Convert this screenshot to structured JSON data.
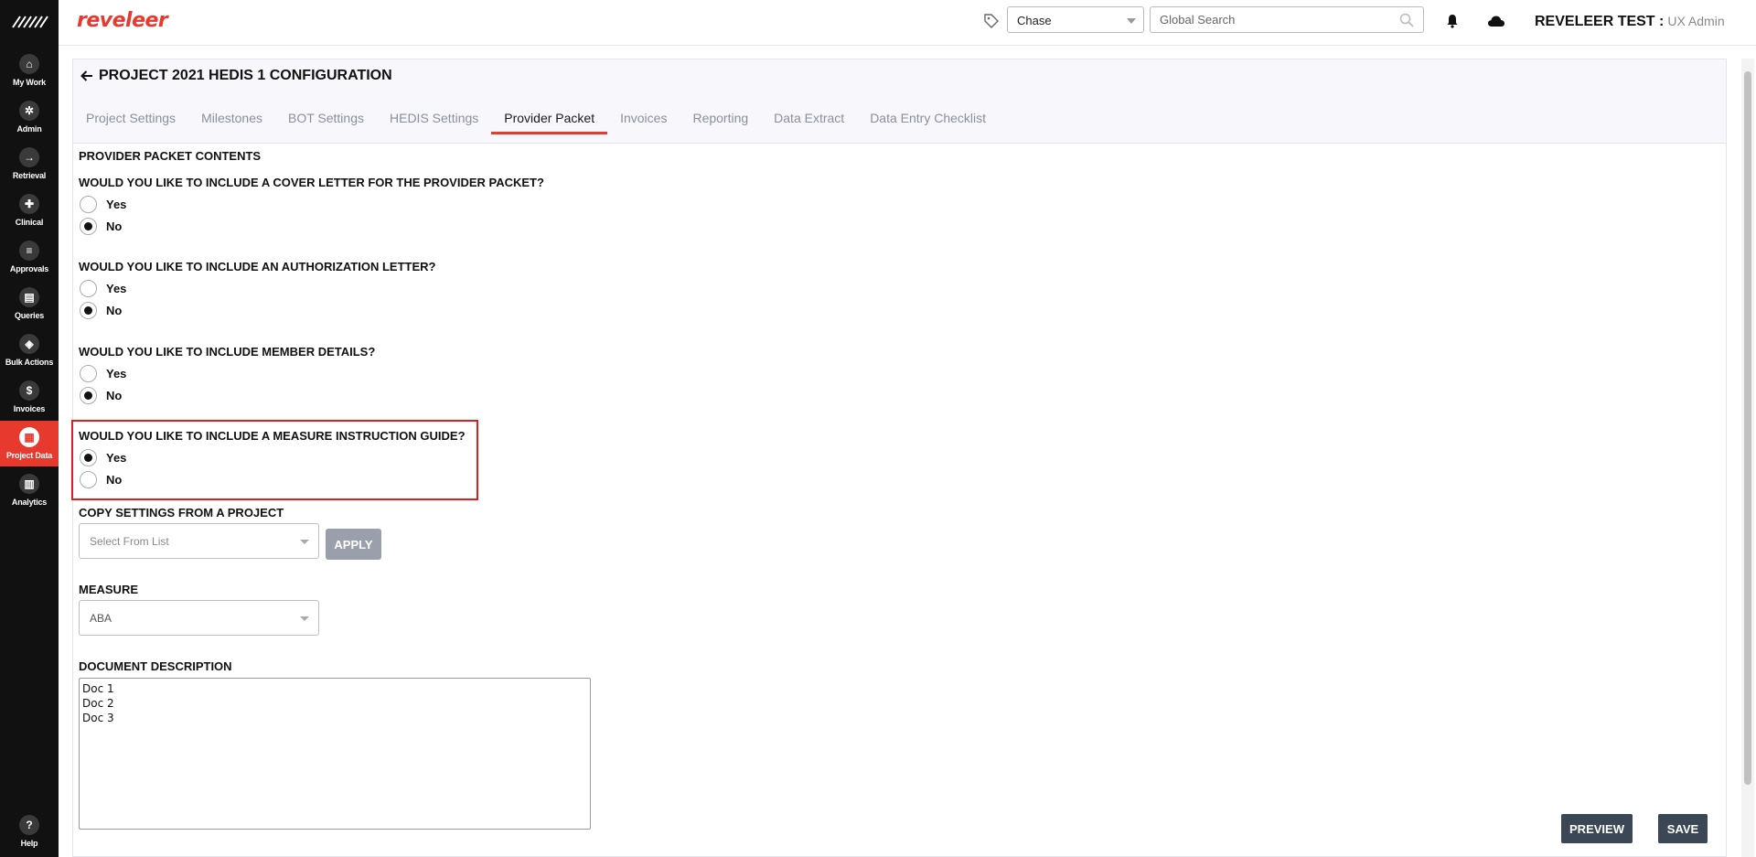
{
  "sidebar": {
    "items": [
      {
        "label": "My Work",
        "icon": "home-icon",
        "glyph": "⌂"
      },
      {
        "label": "Admin",
        "icon": "admin-icon",
        "glyph": "✲"
      },
      {
        "label": "Retrieval",
        "icon": "retrieval-icon",
        "glyph": "→"
      },
      {
        "label": "Clinical",
        "icon": "clinical-icon",
        "glyph": "✚"
      },
      {
        "label": "Approvals",
        "icon": "approvals-icon",
        "glyph": "≡"
      },
      {
        "label": "Queries",
        "icon": "queries-icon",
        "glyph": "▤"
      },
      {
        "label": "Bulk Actions",
        "icon": "layers-icon",
        "glyph": "◈"
      },
      {
        "label": "Invoices",
        "icon": "dollar-icon",
        "glyph": "$"
      },
      {
        "label": "Project Data",
        "icon": "project-data-icon",
        "glyph": "▦"
      },
      {
        "label": "Analytics",
        "icon": "analytics-icon",
        "glyph": "▥"
      }
    ],
    "help": {
      "label": "Help",
      "glyph": "?"
    }
  },
  "header": {
    "brand": "reveleer",
    "org_select": "Chase",
    "search_placeholder": "Global Search",
    "user_name": "REVELEER TEST :",
    "user_role": "UX Admin"
  },
  "page": {
    "title": "PROJECT 2021 HEDIS 1 CONFIGURATION",
    "tabs": [
      "Project Settings",
      "Milestones",
      "BOT Settings",
      "HEDIS Settings",
      "Provider Packet",
      "Invoices",
      "Reporting",
      "Data Extract",
      "Data Entry Checklist"
    ],
    "active_tab": "Provider Packet"
  },
  "form": {
    "section_title": "PROVIDER PACKET CONTENTS",
    "questions": [
      {
        "text": "WOULD YOU LIKE TO INCLUDE A COVER LETTER FOR THE PROVIDER PACKET?",
        "yes": "Yes",
        "no": "No",
        "selected": "No"
      },
      {
        "text": "WOULD YOU LIKE TO INCLUDE AN AUTHORIZATION LETTER?",
        "yes": "Yes",
        "no": "No",
        "selected": "No"
      },
      {
        "text": "WOULD YOU LIKE TO INCLUDE MEMBER DETAILS?",
        "yes": "Yes",
        "no": "No",
        "selected": "No"
      },
      {
        "text": "WOULD YOU LIKE TO INCLUDE A MEASURE INSTRUCTION GUIDE?",
        "yes": "Yes",
        "no": "No",
        "selected": "Yes"
      }
    ],
    "copy_settings": {
      "label": "COPY SETTINGS FROM A PROJECT",
      "placeholder": "Select From List",
      "apply": "APPLY"
    },
    "measure": {
      "label": "MEASURE",
      "value": "ABA"
    },
    "document_description": {
      "label": "DOCUMENT DESCRIPTION",
      "value": "Doc 1\nDoc 2\nDoc 3"
    },
    "preview": "PREVIEW",
    "save": "SAVE"
  },
  "colors": {
    "accent": "#e8392f",
    "sidebar": "#111111",
    "button_dark": "#3b4754",
    "button_disabled": "#9aa0ab"
  }
}
